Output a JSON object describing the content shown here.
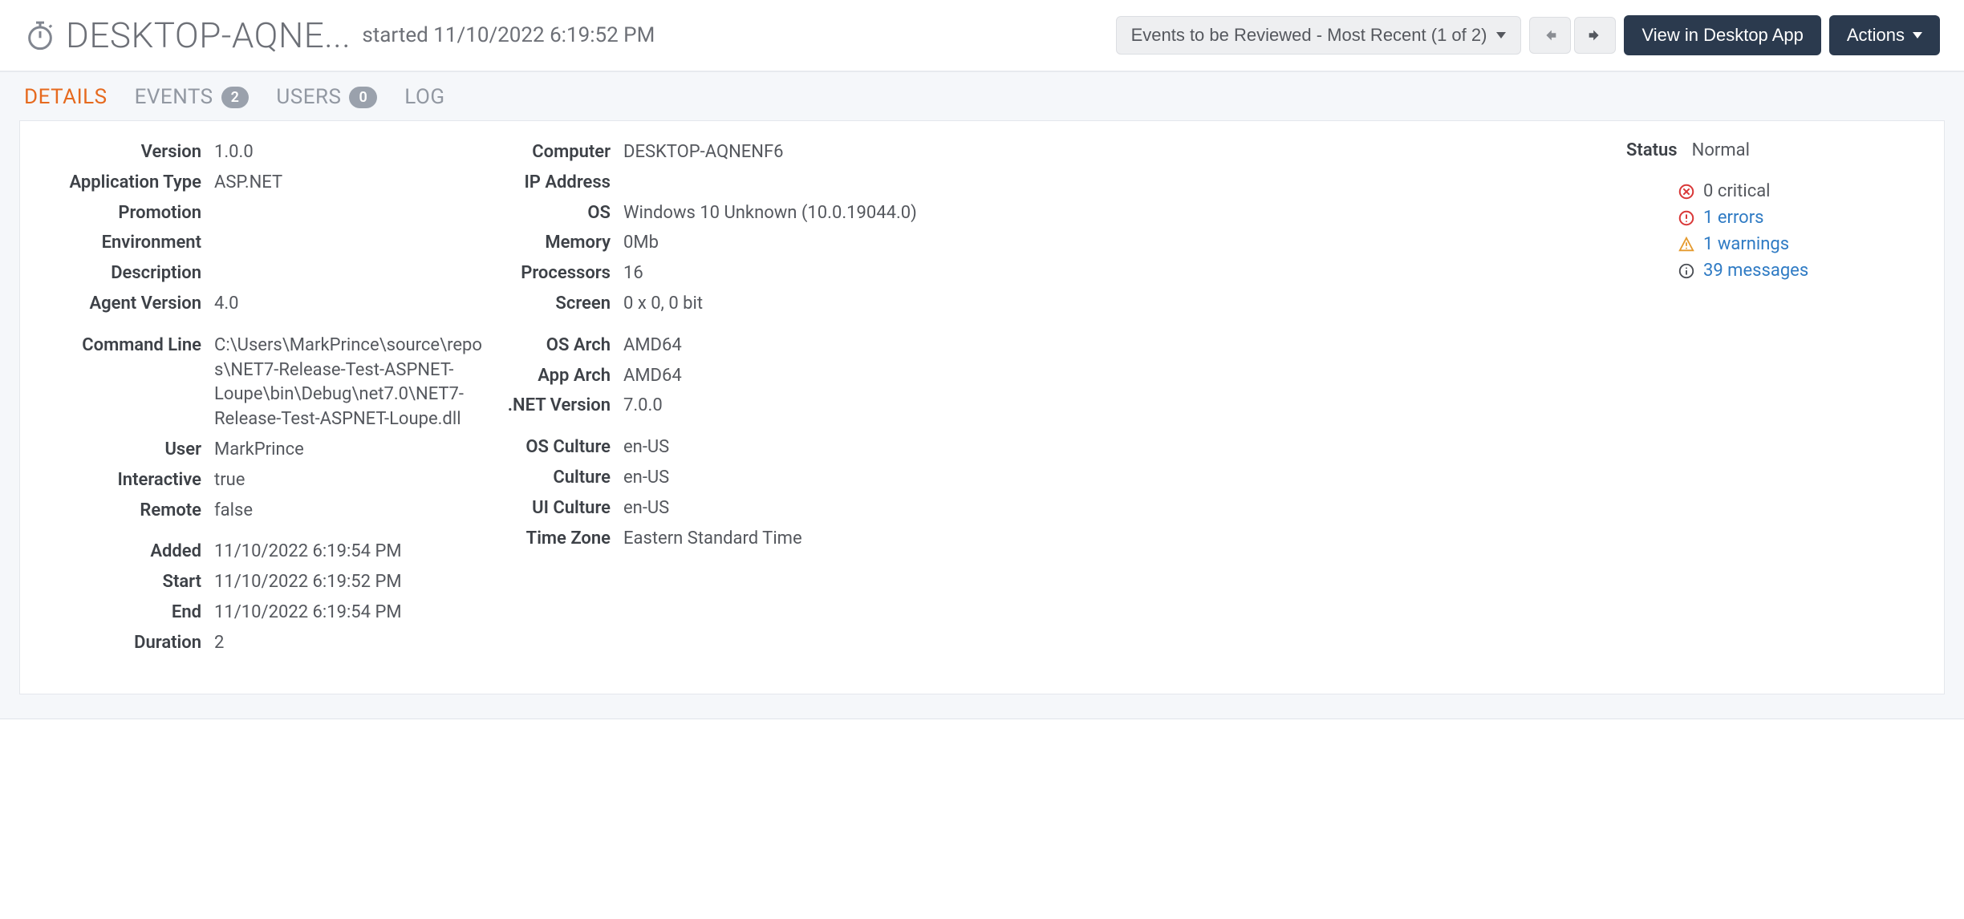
{
  "header": {
    "title": "DESKTOP-AQNE...",
    "subtitle": "started 11/10/2022 6:19:52 PM",
    "dropdown_label": "Events to be Reviewed - Most Recent (1 of 2)",
    "view_desktop_label": "View in Desktop App",
    "actions_label": "Actions"
  },
  "tabs": {
    "details": "DETAILS",
    "events": "EVENTS",
    "events_count": "2",
    "users": "USERS",
    "users_count": "0",
    "log": "LOG"
  },
  "details": {
    "col1": {
      "version_label": "Version",
      "version_value": "1.0.0",
      "apptype_label": "Application Type",
      "apptype_value": "ASP.NET",
      "promotion_label": "Promotion",
      "promotion_value": "",
      "environment_label": "Environment",
      "environment_value": "",
      "description_label": "Description",
      "description_value": "",
      "agentver_label": "Agent Version",
      "agentver_value": "4.0",
      "cmdline_label": "Command Line",
      "cmdline_value": "C:\\Users\\MarkPrince\\source\\repos\\NET7-Release-Test-ASPNET-Loupe\\bin\\Debug\\net7.0\\NET7-Release-Test-ASPNET-Loupe.dll",
      "user_label": "User",
      "user_value": "MarkPrince",
      "interactive_label": "Interactive",
      "interactive_value": "true",
      "remote_label": "Remote",
      "remote_value": "false",
      "added_label": "Added",
      "added_value": "11/10/2022 6:19:54 PM",
      "start_label": "Start",
      "start_value": "11/10/2022 6:19:52 PM",
      "end_label": "End",
      "end_value": "11/10/2022 6:19:54 PM",
      "duration_label": "Duration",
      "duration_value": "2"
    },
    "col2": {
      "computer_label": "Computer",
      "computer_value": "DESKTOP-AQNENF6",
      "ip_label": "IP Address",
      "ip_value": "",
      "os_label": "OS",
      "os_value": "Windows 10 Unknown (10.0.19044.0)",
      "memory_label": "Memory",
      "memory_value": "0Mb",
      "processors_label": "Processors",
      "processors_value": "16",
      "screen_label": "Screen",
      "screen_value": "0 x 0, 0 bit",
      "osarch_label": "OS Arch",
      "osarch_value": "AMD64",
      "apparch_label": "App Arch",
      "apparch_value": "AMD64",
      "netver_label": ".NET Version",
      "netver_value": "7.0.0",
      "osculture_label": "OS Culture",
      "osculture_value": "en-US",
      "culture_label": "Culture",
      "culture_value": "en-US",
      "uiculture_label": "UI Culture",
      "uiculture_value": "en-US",
      "timezone_label": "Time Zone",
      "timezone_value": "Eastern Standard Time"
    },
    "col3": {
      "status_label": "Status",
      "status_value": "Normal",
      "critical": "0 critical",
      "errors": "1 errors",
      "warnings": "1 warnings",
      "messages": "39 messages"
    }
  }
}
